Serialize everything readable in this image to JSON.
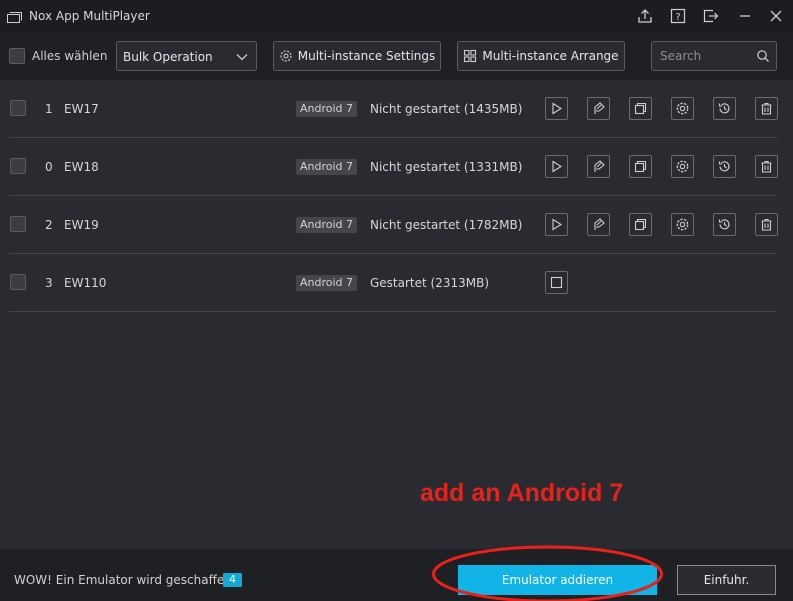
{
  "window": {
    "title": "Nox App MultiPlayer"
  },
  "toolbar": {
    "select_all_label": "Alles wählen",
    "bulk_operation": "Bulk Operation",
    "settings_label": "Multi-instance Settings",
    "arrange_label": "Multi-instance Arrange",
    "search_placeholder": "Search"
  },
  "instances": [
    {
      "index": "1",
      "name": "EW17",
      "version": "Android 7",
      "status": "Nicht gestartet (1435MB)",
      "running": false
    },
    {
      "index": "0",
      "name": "EW18",
      "version": "Android 7",
      "status": "Nicht gestartet (1331MB)",
      "running": false
    },
    {
      "index": "2",
      "name": "EW19",
      "version": "Android 7",
      "status": "Nicht gestartet (1782MB)",
      "running": false
    },
    {
      "index": "3",
      "name": "EW110",
      "version": "Android 7",
      "status": "Gestartet (2313MB)",
      "running": true
    }
  ],
  "annotation": {
    "text": "add an Android 7",
    "color": "#e8211a"
  },
  "footer": {
    "message": "WOW! Ein Emulator wird geschaffen:",
    "count": "4",
    "add_label": "Emulator addieren",
    "import_label": "Einfuhr."
  },
  "colors": {
    "accent": "#12b3e6",
    "background": "#2a2b30",
    "titlebar": "#1c1d21"
  }
}
